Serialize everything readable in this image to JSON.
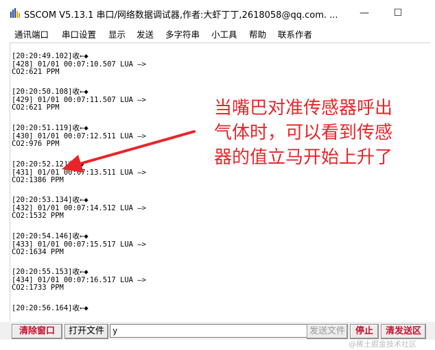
{
  "window": {
    "title": "SSCOM V5.13.1 串口/网络数据调试器,作者:大虾丁丁,2618058@qq.com. ...",
    "minimize_label": "—",
    "maximize_label": "☐"
  },
  "menu": [
    "通讯端口",
    "串口设置",
    "显示",
    "发送",
    "多字符串",
    "小工具",
    "帮助",
    "联系作者"
  ],
  "log": [
    {
      "time": "[20:20:49.102]收←◆",
      "line": "[428] 01/01 00:07:10.507 LUA —>",
      "co2": "CO2:621 PPM"
    },
    {
      "time": "[20:20:50.108]收←◆",
      "line": "[429] 01/01 00:07:11.507 LUA —>",
      "co2": "CO2:621 PPM"
    },
    {
      "time": "[20:20:51.119]收←◆",
      "line": "[430] 01/01 00:07:12.511 LUA —>",
      "co2": "CO2:976 PPM"
    },
    {
      "time": "[20:20:52.12]收←◆",
      "line": "[431] 01/01 00:07:13.511 LUA —>",
      "co2": "CO2:1386 PPM"
    },
    {
      "time": "[20:20:53.134]收←◆",
      "line": "[432] 01/01 00:07:14.512 LUA —>",
      "co2": "CO2:1532 PPM"
    },
    {
      "time": "[20:20:54.146]收←◆",
      "line": "[433] 01/01 00:07:15.517 LUA —>",
      "co2": "CO2:1634 PPM"
    },
    {
      "time": "[20:20:55.153]收←◆",
      "line": "[434] 01/01 00:07:16.517 LUA —>",
      "co2": "CO2:1733 PPM"
    },
    {
      "time": "[20:20:56.164]收←◆",
      "line": "",
      "co2": ""
    }
  ],
  "annotation": {
    "lines": [
      "当嘴巴对准传感器呼出",
      "气体时，可以看到传感",
      "器的值立马开始上升了"
    ],
    "color": "#e8252a"
  },
  "toolbar": {
    "clear_label": "清除窗口",
    "open_file_label": "打开文件",
    "input_value": "y",
    "send_file_label": "发送文件",
    "stop_label": "停止",
    "clear_send_label": "清发送区"
  },
  "watermark": "@稀土掘金技术社区"
}
